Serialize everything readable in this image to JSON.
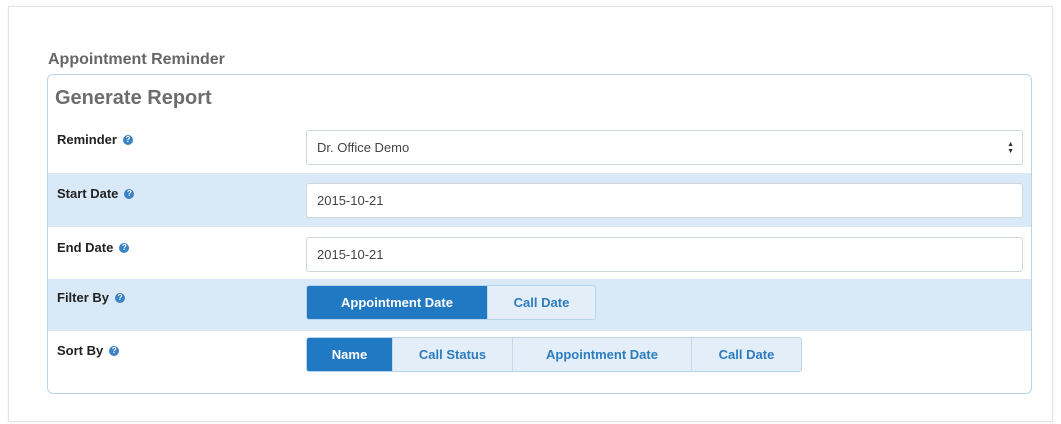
{
  "page": {
    "section_title": "Appointment Reminder",
    "panel_title": "Generate Report"
  },
  "form": {
    "reminder": {
      "label": "Reminder",
      "value": "Dr. Office Demo"
    },
    "start_date": {
      "label": "Start Date",
      "value": "2015-10-21"
    },
    "end_date": {
      "label": "End Date",
      "value": "2015-10-21"
    },
    "filter_by": {
      "label": "Filter By",
      "options": [
        "Appointment Date",
        "Call Date"
      ],
      "selected": "Appointment Date"
    },
    "sort_by": {
      "label": "Sort By",
      "options": [
        "Name",
        "Call Status",
        "Appointment Date",
        "Call Date"
      ],
      "selected": "Name"
    }
  },
  "icons": {
    "help": "help-icon",
    "select_arrows": "updown-arrows-icon"
  },
  "colors": {
    "accent": "#2179c4",
    "stripe": "#d9e9f7",
    "panel_border": "#b9d5ec"
  }
}
